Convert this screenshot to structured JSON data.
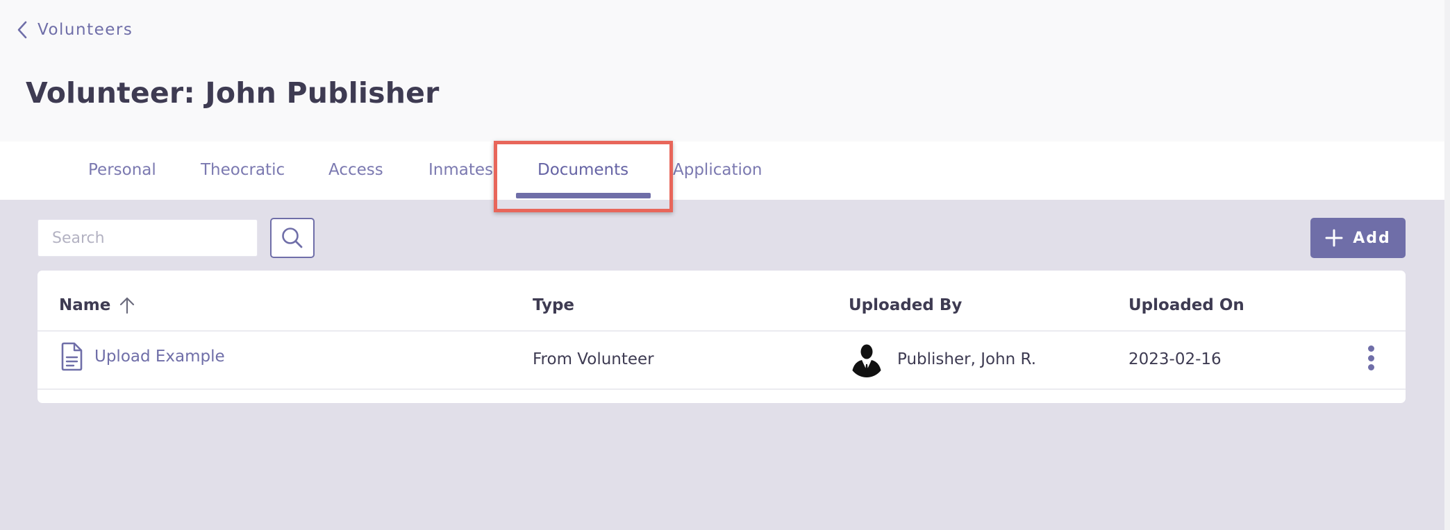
{
  "nav": {
    "back_label": "Volunteers"
  },
  "page": {
    "title": "Volunteer: John Publisher"
  },
  "tabs": [
    {
      "label": "Personal",
      "active": false
    },
    {
      "label": "Theocratic",
      "active": false
    },
    {
      "label": "Access",
      "active": false
    },
    {
      "label": "Inmates",
      "active": false
    },
    {
      "label": "Documents",
      "active": true
    },
    {
      "label": "Application",
      "active": false
    }
  ],
  "toolbar": {
    "search_placeholder": "Search",
    "search_value": "",
    "add_label": "Add"
  },
  "table": {
    "columns": [
      "Name",
      "Type",
      "Uploaded By",
      "Uploaded On"
    ],
    "sort": {
      "column": "Name",
      "direction": "ascending"
    },
    "rows": [
      {
        "name": "Upload Example",
        "type": "From Volunteer",
        "uploaded_by": "Publisher, John R.",
        "uploaded_on": "2023-02-16"
      }
    ]
  },
  "colors": {
    "accent": "#6f6ea8",
    "background": "#e1dfe9",
    "text": "#3e3b52",
    "highlight": "#e8665a"
  },
  "icons": {
    "back": "chevron-left-icon",
    "search": "search-icon",
    "add": "plus-icon",
    "sort": "arrow-up-icon",
    "document": "document-icon",
    "menu": "kebab-menu-icon"
  }
}
